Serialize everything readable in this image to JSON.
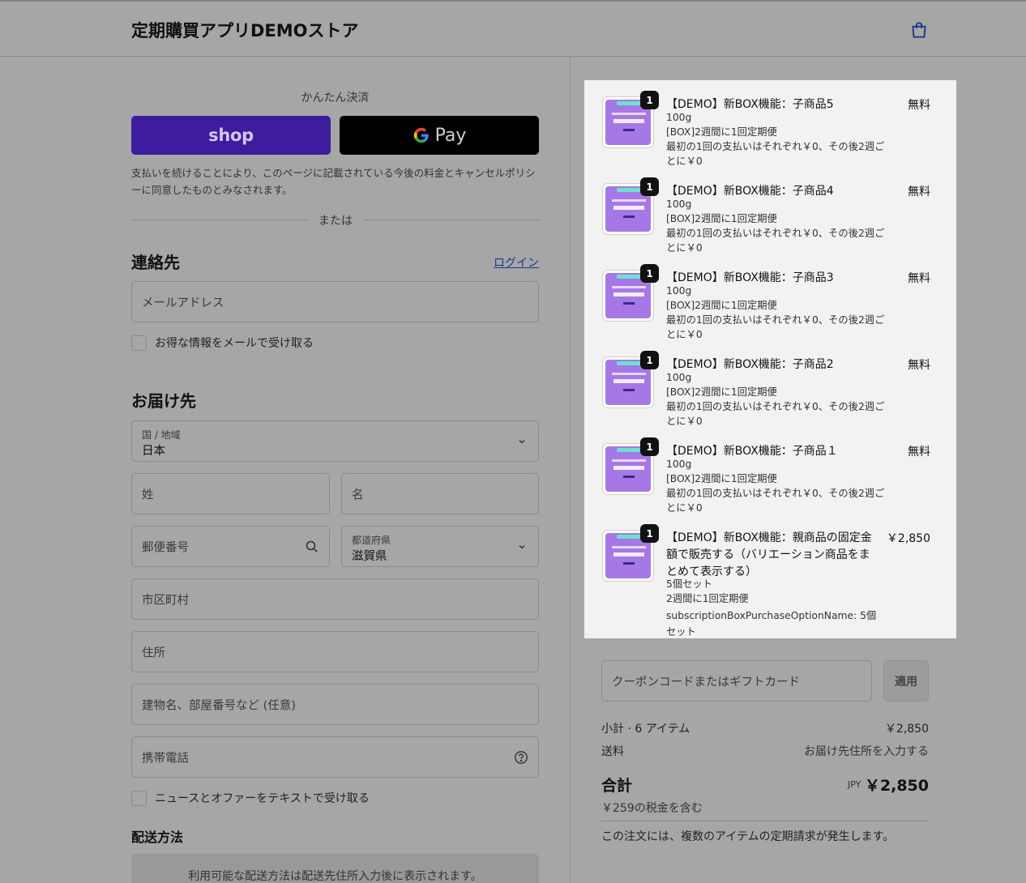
{
  "header": {
    "store_title": "定期購買アプリDEMOストア",
    "cart_icon": "shopping-bag-icon"
  },
  "express": {
    "label": "かんたん決済",
    "shop_label": "shop",
    "gpay_label": "Pay",
    "policy": "支払いを続けることにより、このページに記載されている今後の料金とキャンセルポリシーに同意したものとみなされます。",
    "or": "または"
  },
  "contact": {
    "heading": "連絡先",
    "login": "ログイン",
    "email_placeholder": "メールアドレス",
    "newsletter": "お得な情報をメールで受け取る"
  },
  "delivery": {
    "heading": "お届け先",
    "country_label": "国 / 地域",
    "country_value": "日本",
    "last_name": "姓",
    "first_name": "名",
    "postal": "郵便番号",
    "prefecture_label": "都道府県",
    "prefecture_value": "滋賀県",
    "city": "市区町村",
    "address": "住所",
    "building": "建物名、部屋番号など (任意)",
    "phone": "携帯電話",
    "sms_optin": "ニュースとオファーをテキストで受け取る"
  },
  "shipping": {
    "heading": "配送方法",
    "note": "利用可能な配送方法は配送先住所入力後に表示されます。"
  },
  "items": [
    {
      "qty": "1",
      "name": "【DEMO】新BOX機能：子商品5",
      "price": "無料",
      "lines": [
        "100g",
        "[BOX]2週間に1回定期便",
        "最初の1回の支払いはそれぞれ￥0、その後2週ごとに￥0"
      ]
    },
    {
      "qty": "1",
      "name": "【DEMO】新BOX機能：子商品4",
      "price": "無料",
      "lines": [
        "100g",
        "[BOX]2週間に1回定期便",
        "最初の1回の支払いはそれぞれ￥0、その後2週ごとに￥0"
      ]
    },
    {
      "qty": "1",
      "name": "【DEMO】新BOX機能：子商品3",
      "price": "無料",
      "lines": [
        "100g",
        "[BOX]2週間に1回定期便",
        "最初の1回の支払いはそれぞれ￥0、その後2週ごとに￥0"
      ]
    },
    {
      "qty": "1",
      "name": "【DEMO】新BOX機能：子商品2",
      "price": "無料",
      "lines": [
        "100g",
        "[BOX]2週間に1回定期便",
        "最初の1回の支払いはそれぞれ￥0、その後2週ごとに￥0"
      ]
    },
    {
      "qty": "1",
      "name": "【DEMO】新BOX機能：子商品１",
      "price": "無料",
      "lines": [
        "100g",
        "[BOX]2週間に1回定期便",
        "最初の1回の支払いはそれぞれ￥0、その後2週ごとに￥0"
      ]
    },
    {
      "qty": "1",
      "name": "【DEMO】新BOX機能：親商品の固定金額で販売する（バリエーション商品をまとめて表示する）",
      "price": "￥2,850",
      "lines": [
        "5個セット",
        "2週間に1回定期便",
        "subscriptionBoxPurchaseOptionName: 5個セット"
      ]
    }
  ],
  "coupon": {
    "placeholder": "クーポンコードまたはギフトカード",
    "apply": "適用"
  },
  "summary": {
    "subtotal_label": "小計 · 6 アイテム",
    "subtotal_value": "￥2,850",
    "shipping_label": "送料",
    "shipping_value": "お届け先住所を入力する",
    "total_label": "合計",
    "currency": "JPY",
    "total_value": "￥2,850",
    "tax_note": "￥259の税金を含む",
    "subscription_note": "この注文には、複数のアイテムの定期請求が発生します。"
  }
}
